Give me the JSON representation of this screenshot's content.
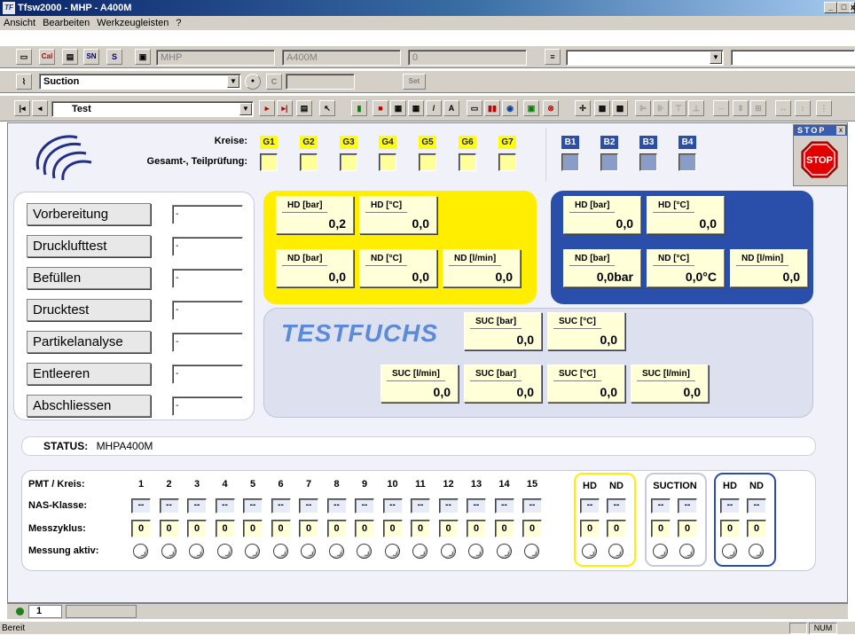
{
  "window": {
    "title": "Tfsw2000 - MHP - A400M",
    "app_icon": "TF"
  },
  "menu": [
    "Ansicht",
    "Bearbeiten",
    "Werkzeugleisten",
    "?"
  ],
  "toolbar1": {
    "btn_cal": "Cal",
    "btn_sn": "SN",
    "btn_s": "S",
    "field_mhp": "MHP",
    "field_a400m": "A400M",
    "field_zero": "0"
  },
  "toolbar2": {
    "suction_combo": "Suction",
    "btn_c": "C",
    "btn_set": "Set"
  },
  "toolbar3": {
    "test_combo": "Test"
  },
  "stop": {
    "title": "STOP",
    "close": "x",
    "sign": "STOP"
  },
  "kreise": {
    "label1": "Kreise:",
    "label2": "Gesamt-, Teilprüfung:",
    "g": [
      "G1",
      "G2",
      "G3",
      "G4",
      "G5",
      "G6",
      "G7"
    ],
    "b": [
      "B1",
      "B2",
      "B3",
      "B4"
    ]
  },
  "steps": [
    {
      "label": "Vorbereitung",
      "value": "-"
    },
    {
      "label": "Drucklufttest",
      "value": "-"
    },
    {
      "label": "Befüllen",
      "value": "-"
    },
    {
      "label": "Drucktest",
      "value": "-"
    },
    {
      "label": "Partikelanalyse",
      "value": "-"
    },
    {
      "label": "Entleeren",
      "value": "-"
    },
    {
      "label": "Abschliessen",
      "value": "-"
    }
  ],
  "yellow": {
    "hd_bar": {
      "label": "HD [bar]",
      "value": "0,2"
    },
    "hd_c": {
      "label": "HD [°C]",
      "value": "0,0"
    },
    "nd_bar": {
      "label": "ND [bar]",
      "value": "0,0"
    },
    "nd_c": {
      "label": "ND [°C]",
      "value": "0,0"
    },
    "nd_lmin": {
      "label": "ND [l/min]",
      "value": "0,0"
    }
  },
  "blue": {
    "hd_bar": {
      "label": "HD [bar]",
      "value": "0,0"
    },
    "hd_c": {
      "label": "HD [°C]",
      "value": "0,0"
    },
    "nd_bar": {
      "label": "ND [bar]",
      "value": "0,0bar"
    },
    "nd_c": {
      "label": "ND [°C]",
      "value": "0,0°C"
    },
    "nd_lmin": {
      "label": "ND [l/min]",
      "value": "0,0"
    }
  },
  "suction": {
    "logo": "TESTFUCHS",
    "suc1_bar": {
      "label": "SUC [bar]",
      "value": "0,0"
    },
    "suc1_c": {
      "label": "SUC [°C]",
      "value": "0,0"
    },
    "suc1_lmin": {
      "label": "SUC [l/min]",
      "value": "0,0"
    },
    "suc2_bar": {
      "label": "SUC [bar]",
      "value": "0,0"
    },
    "suc2_c": {
      "label": "SUC [°C]",
      "value": "0,0"
    },
    "suc2_lmin": {
      "label": "SUC [l/min]",
      "value": "0,0"
    }
  },
  "status": {
    "label": "STATUS:",
    "value": "MHPA400M"
  },
  "pmt": {
    "row_labels": {
      "kreis": "PMT / Kreis:",
      "nas": "NAS-Klasse:",
      "mess": "Messzyklus:",
      "aktiv": "Messung aktiv:"
    },
    "numbers": [
      "1",
      "2",
      "3",
      "4",
      "5",
      "6",
      "7",
      "8",
      "9",
      "10",
      "11",
      "12",
      "13",
      "14",
      "15"
    ],
    "nas_value": "--",
    "mess_value": "0",
    "group_hd": "HD",
    "group_nd": "ND",
    "group_suction": "SUCTION",
    "colors": {
      "yellow": "#ffff00",
      "suction": "#c8c8e0",
      "blue": "#2a4faa"
    }
  },
  "bottom": {
    "tab": "1"
  },
  "statusbar": {
    "left": "Bereit",
    "num": "NUM"
  }
}
